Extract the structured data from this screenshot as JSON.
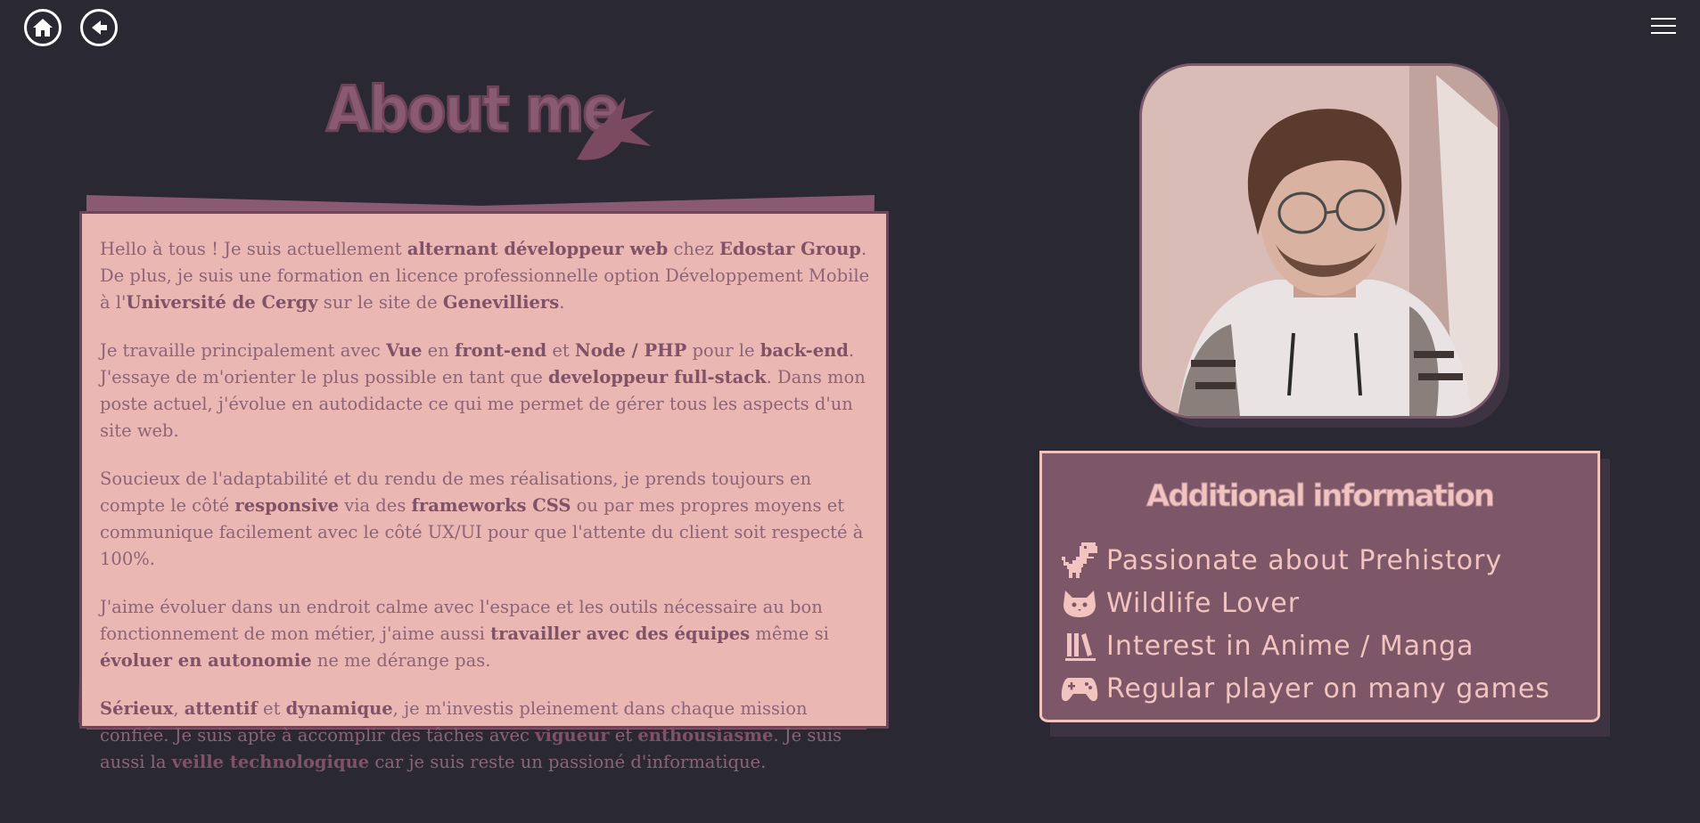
{
  "header": {
    "home_icon": "home-icon",
    "back_icon": "arrow-left-circle-icon",
    "menu_icon": "hamburger-menu-icon"
  },
  "about": {
    "title": "About me",
    "paragraphs": [
      [
        {
          "t": "Hello à tous !  Je suis actuellement "
        },
        {
          "t": "alternant développeur web",
          "b": true
        },
        {
          "t": " chez "
        },
        {
          "t": "Edostar Group",
          "b": true
        },
        {
          "t": ".  De plus, je suis une formation en licence professionnelle option Développement Mobile à l'"
        },
        {
          "t": "Université de Cergy",
          "b": true
        },
        {
          "t": " sur le site de "
        },
        {
          "t": "Genevilliers",
          "b": true
        },
        {
          "t": "."
        }
      ],
      [
        {
          "t": "Je travaille principalement avec "
        },
        {
          "t": "Vue",
          "b": true
        },
        {
          "t": " en "
        },
        {
          "t": "front-end",
          "b": true
        },
        {
          "t": " et "
        },
        {
          "t": "Node / PHP",
          "b": true
        },
        {
          "t": " pour le "
        },
        {
          "t": "back-end",
          "b": true
        },
        {
          "t": ".  J'essaye de m'orienter le plus possible en tant que "
        },
        {
          "t": "developpeur full-stack",
          "b": true
        },
        {
          "t": ".  Dans mon poste actuel, j'évolue en autodidacte ce qui me permet de gérer tous les aspects d'un site web."
        }
      ],
      [
        {
          "t": "Soucieux de l'adaptabilité et du rendu de mes réalisations,  je prends toujours en compte le côté "
        },
        {
          "t": "responsive",
          "b": true
        },
        {
          "t": " via des "
        },
        {
          "t": "frameworks CSS",
          "b": true
        },
        {
          "t": " ou par mes propres moyens et communique facilement avec le côté UX/UI pour que l'attente du client soit respecté à 100%."
        }
      ],
      [
        {
          "t": "J'aime évoluer dans un endroit calme avec l'espace et les outils nécessaire au bon fonctionnement de mon métier,  j'aime aussi "
        },
        {
          "t": "travailler avec des équipes",
          "b": true
        },
        {
          "t": " même si "
        },
        {
          "t": "évoluer en autonomie",
          "b": true
        },
        {
          "t": " ne me dérange pas."
        }
      ],
      [
        {
          "t": "Sérieux",
          "b": true
        },
        {
          "t": ",  "
        },
        {
          "t": "attentif",
          "b": true
        },
        {
          "t": " et "
        },
        {
          "t": "dynamique",
          "b": true
        },
        {
          "t": ",  je m'investis pleinement dans chaque mission confiée.  Je suis apte à accomplir des tâches avec "
        },
        {
          "t": "vigueur",
          "b": true
        },
        {
          "t": " et "
        },
        {
          "t": "enthousiasme",
          "b": true
        },
        {
          "t": ".  Je suis aussi la "
        },
        {
          "t": "veille technologique",
          "b": true
        },
        {
          "t": " car je suis reste un passioné d'informatique."
        }
      ]
    ]
  },
  "info": {
    "title": "Additional information",
    "items": [
      {
        "icon": "dinosaur-icon",
        "label": "Passionate about Prehistory"
      },
      {
        "icon": "cat-icon",
        "label": "Wildlife Lover"
      },
      {
        "icon": "books-icon",
        "label": "Interest in Anime / Manga"
      },
      {
        "icon": "gamepad-icon",
        "label": "Regular player on many games"
      }
    ]
  },
  "colors": {
    "background": "#2a2833",
    "card": "#ebb7b2",
    "accent": "#7d5668",
    "light_pink": "#f1c4c0"
  }
}
